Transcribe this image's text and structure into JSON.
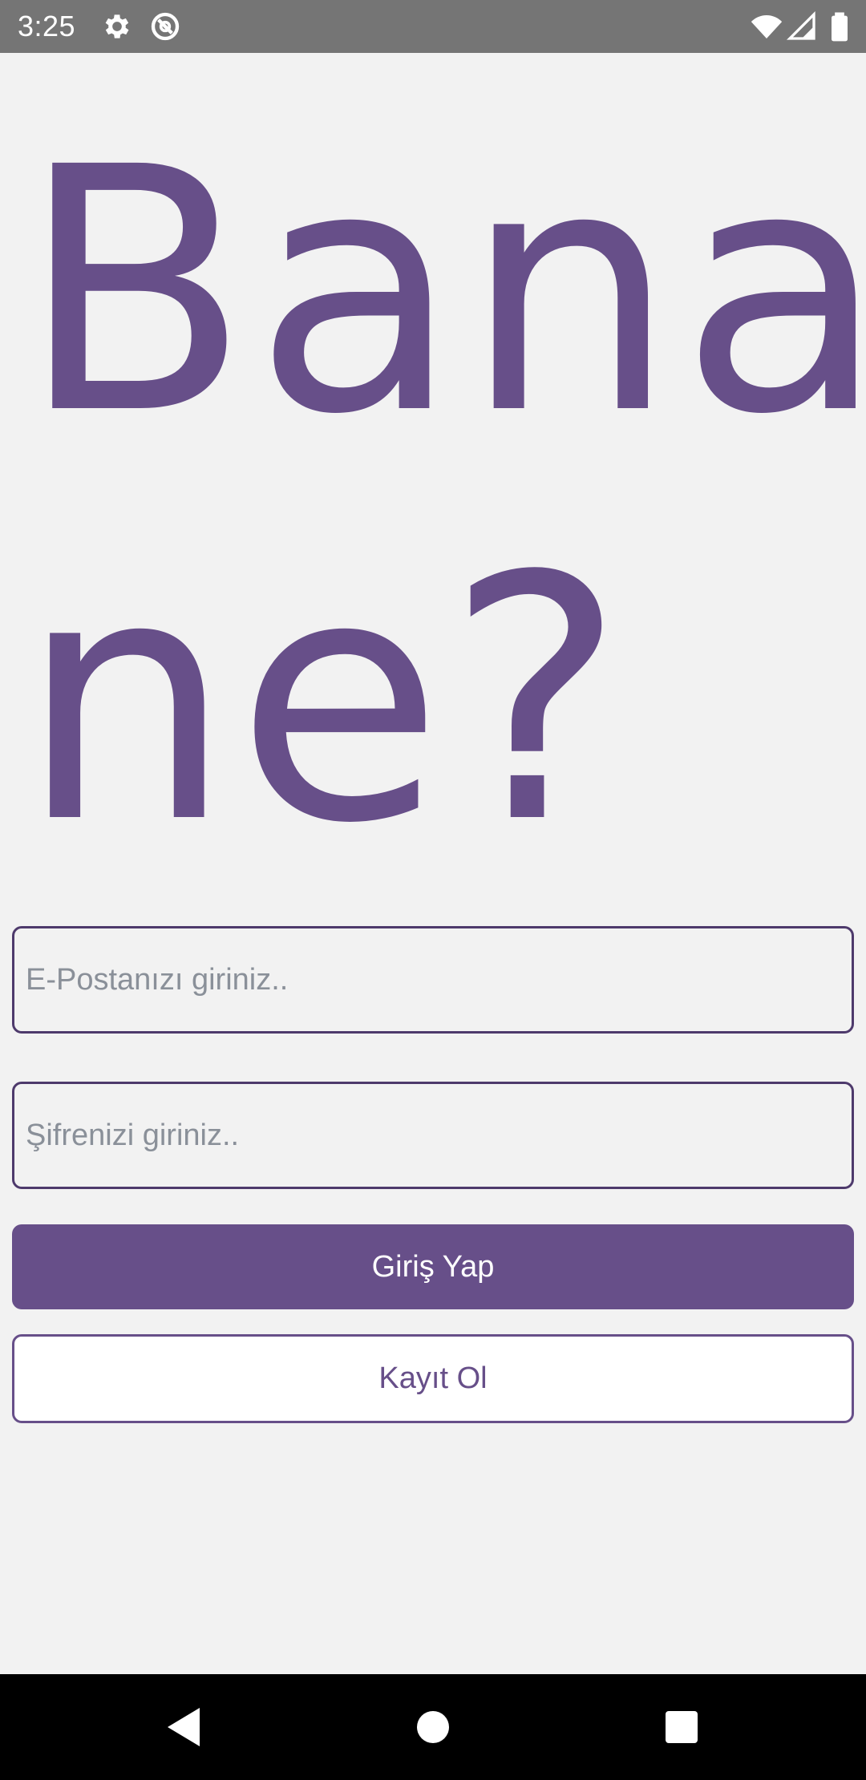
{
  "status_bar": {
    "time": "3:25",
    "icons": [
      "gear-icon",
      "do-not-disturb-icon",
      "wifi-icon",
      "signal-icon",
      "battery-icon"
    ]
  },
  "hero": {
    "line1": "Bana",
    "line2": "ne?"
  },
  "form": {
    "email_placeholder": "E-Postanızı giriniz..",
    "password_placeholder": "Şifrenizi giriniz.."
  },
  "buttons": {
    "login_label": "Giriş Yap",
    "register_label": "Kayıt Ol"
  },
  "colors": {
    "accent": "#674f89",
    "background": "#f2f2f2",
    "status_bar": "#757575",
    "nav_bar": "#000000"
  },
  "nav_bar": {
    "icons": [
      "back-icon",
      "home-icon",
      "recents-icon"
    ]
  }
}
